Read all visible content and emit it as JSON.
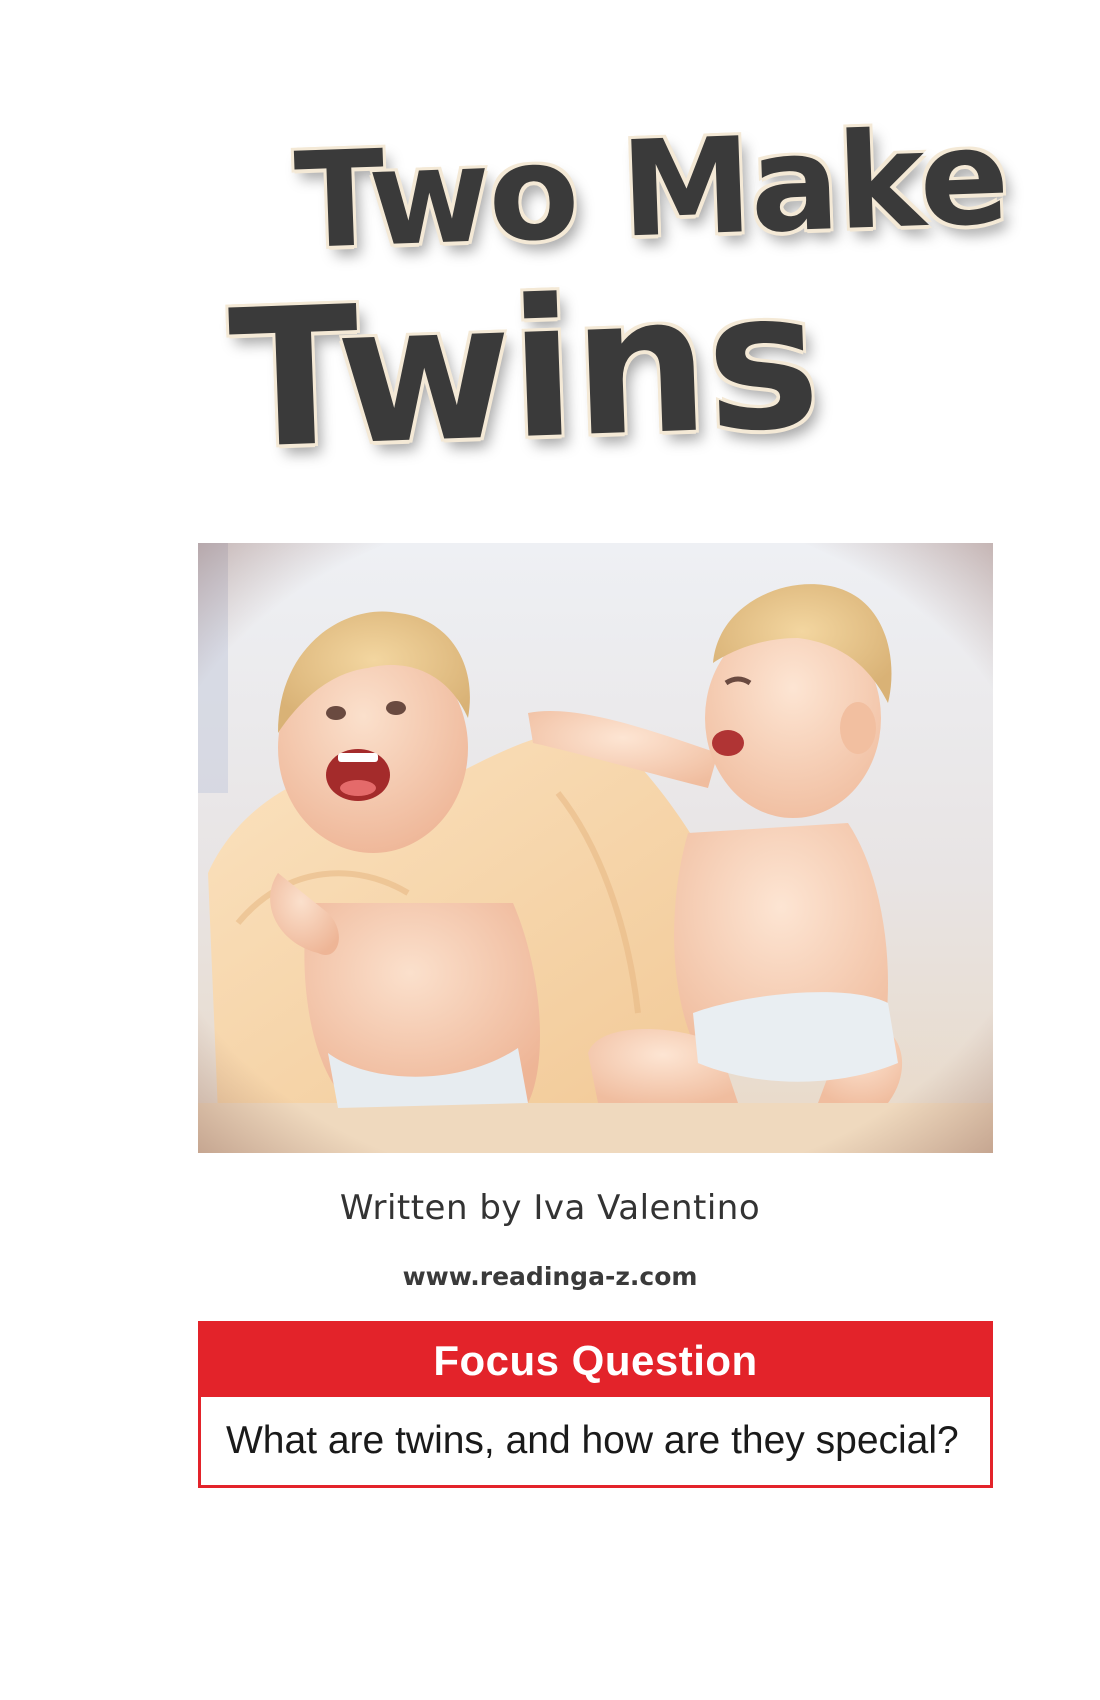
{
  "cover": {
    "title_line_1": "Two Make",
    "title_line_2": "Twins",
    "byline": "Written by Iva Valentino",
    "website": "www.readinga-z.com"
  },
  "photo": {
    "icon": "twin-babies-photo"
  },
  "focus": {
    "heading": "Focus Question",
    "question": "What are twins, and how are they special?"
  },
  "colors": {
    "focus_red": "#e3232a",
    "title_ink": "#3a3a3a",
    "title_outline": "#f4e9d6"
  }
}
